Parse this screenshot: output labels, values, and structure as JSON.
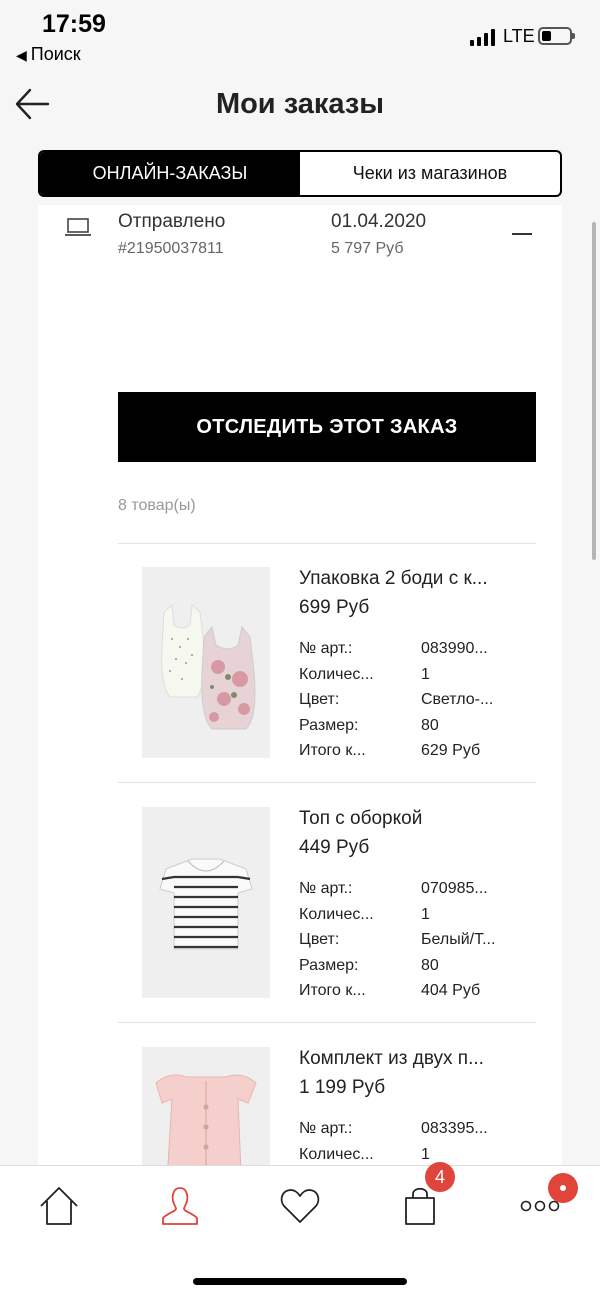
{
  "status_bar": {
    "time": "17:59",
    "back_app": "Поиск",
    "network": "LTE"
  },
  "header": {
    "title": "Мои заказы"
  },
  "tabs": [
    {
      "label": "ОНЛАЙН-ЗАКАЗЫ",
      "active": true
    },
    {
      "label": "Чеки из магазинов",
      "active": false
    }
  ],
  "order": {
    "icon": "laptop-icon",
    "status": "Отправлено",
    "number": "#21950037811",
    "date": "01.04.2020",
    "total": "5 797 Руб",
    "track_button": "ОТСЛЕДИТЬ ЭТОТ ЗАКАЗ",
    "items_count": "8 товар(ы)"
  },
  "items": [
    {
      "name": "Упаковка 2 боди с к...",
      "price": "699 Руб",
      "attrs": [
        {
          "label": "№ арт.:",
          "value": "083990..."
        },
        {
          "label": "Количес...",
          "value": "1"
        },
        {
          "label": "Цвет:",
          "value": "Светло-..."
        },
        {
          "label": "Размер:",
          "value": "80"
        },
        {
          "label": "Итого к...",
          "value": "629 Руб"
        }
      ]
    },
    {
      "name": "Топ с оборкой",
      "price": "449 Руб",
      "attrs": [
        {
          "label": "№ арт.:",
          "value": "070985..."
        },
        {
          "label": "Количес...",
          "value": "1"
        },
        {
          "label": "Цвет:",
          "value": "Белый/Т..."
        },
        {
          "label": "Размер:",
          "value": "80"
        },
        {
          "label": "Итого к...",
          "value": "404 Руб"
        }
      ]
    },
    {
      "name": "Комплект из двух п...",
      "price": "1 199 Руб",
      "attrs": [
        {
          "label": "№ арт.:",
          "value": "083395..."
        },
        {
          "label": "Количес...",
          "value": "1"
        }
      ]
    }
  ],
  "bottom_nav": {
    "items": [
      "home-icon",
      "profile-icon",
      "heart-icon",
      "bag-icon",
      "more-icon"
    ],
    "bag_badge": "4",
    "accent_color": "#e0443b"
  }
}
